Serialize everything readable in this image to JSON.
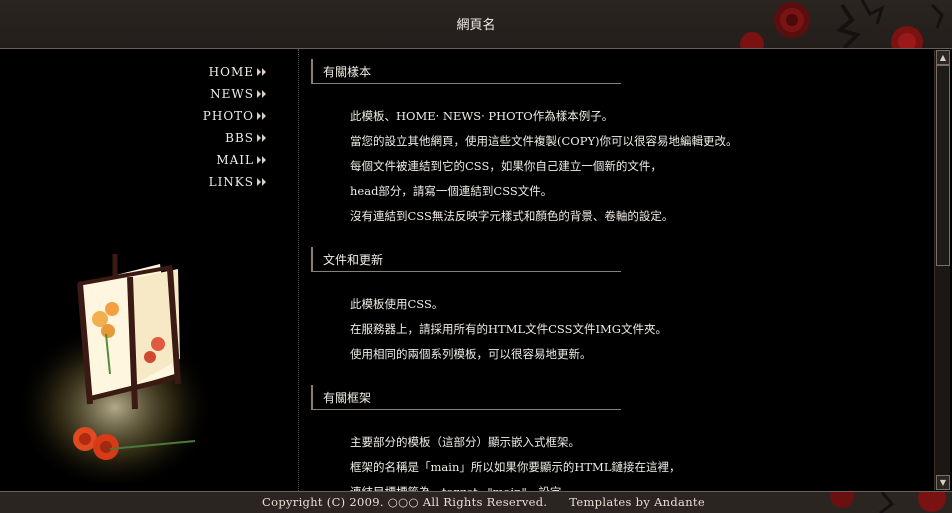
{
  "header": {
    "title": "網頁名"
  },
  "nav": {
    "items": [
      {
        "label": "HOME",
        "icon": "double-arrow-icon"
      },
      {
        "label": "NEWS",
        "icon": "double-arrow-icon"
      },
      {
        "label": "PHOTO",
        "icon": "double-arrow-icon"
      },
      {
        "label": "BBS",
        "icon": "double-arrow-icon"
      },
      {
        "label": "MAIL",
        "icon": "double-arrow-icon"
      },
      {
        "label": "LINKS",
        "icon": "double-arrow-icon"
      }
    ]
  },
  "content": {
    "sections": [
      {
        "title": "有關樣本",
        "lines": [
          "此模板、HOME‧ NEWS‧ PHOTO作為樣本例子。",
          "當您的設立其他網頁，使用這些文件複製(COPY)你可以很容易地編輯更改。",
          "每個文件被連結到它的CSS，如果你自己建立一個新的文件，",
          "head部分，請寫一個連結到CSS文件。",
          "沒有連結到CSS無法反映字元樣式和顏色的背景、卷軸的設定。"
        ]
      },
      {
        "title": "文件和更新",
        "lines": [
          "此模板使用CSS。",
          "在服務器上，請採用所有的HTML文件CSS文件IMG文件夾。",
          "使用相同的兩個系列模板，可以很容易地更新。"
        ]
      },
      {
        "title": "有關框架",
        "lines": [
          "主要部分的模板（這部分）顯示嵌入式框架。",
          "框架的名稱是「main」所以如果你要顯示的HTML鏈接在這裡，",
          "連結目標標籤為　target=\"main\"　設定。"
        ]
      }
    ]
  },
  "scrollbar": {
    "up": "▲",
    "down": "▼"
  },
  "footer": {
    "copyright": "Copyright (C) 2009. ○○○ All Rights Reserved.",
    "credit": "Templates by Andante"
  },
  "colors": {
    "background": "#000000",
    "bar": "#2b2521",
    "flower": "#8a1010"
  }
}
